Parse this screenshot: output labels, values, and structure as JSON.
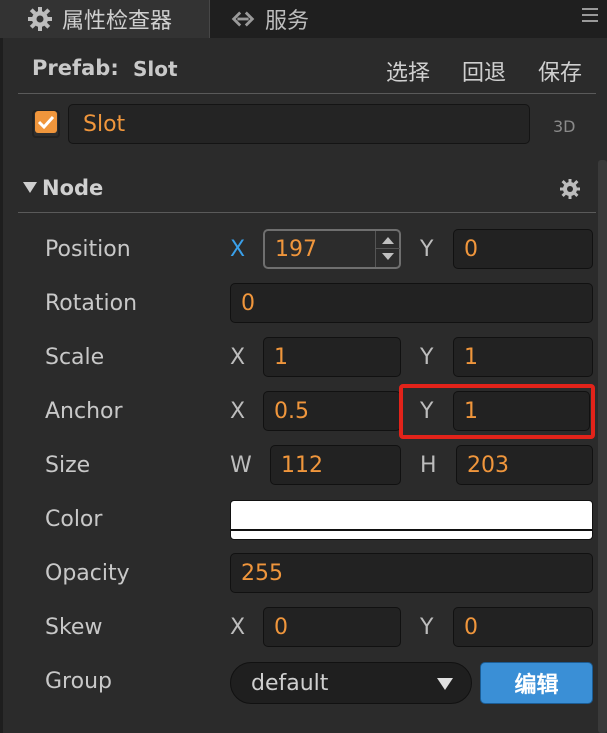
{
  "tabs": {
    "inspector": {
      "label": "属性检查器",
      "icon": "gear-icon"
    },
    "services": {
      "label": "服务",
      "icon": "link-icon"
    },
    "menu_icon": "hamburger-icon"
  },
  "prefab": {
    "label": "Prefab:",
    "name": "Slot",
    "select_label": "选择",
    "revert_label": "回退",
    "save_label": "保存"
  },
  "node_name": {
    "checked": true,
    "value": "Slot",
    "mode_label": "3D"
  },
  "node_section": {
    "title": "Node",
    "settings_icon": "gear-icon"
  },
  "properties": {
    "position": {
      "label": "Position",
      "x_axis": "X",
      "x": "197",
      "y_axis": "Y",
      "y": "0"
    },
    "rotation": {
      "label": "Rotation",
      "value": "0"
    },
    "scale": {
      "label": "Scale",
      "x_axis": "X",
      "x": "1",
      "y_axis": "Y",
      "y": "1"
    },
    "anchor": {
      "label": "Anchor",
      "x_axis": "X",
      "x": "0.5",
      "y_axis": "Y",
      "y": "1"
    },
    "size": {
      "label": "Size",
      "w_axis": "W",
      "w": "112",
      "h_axis": "H",
      "h": "203"
    },
    "color": {
      "label": "Color",
      "value": "#ffffff"
    },
    "opacity": {
      "label": "Opacity",
      "value": "255"
    },
    "skew": {
      "label": "Skew",
      "x_axis": "X",
      "x": "0",
      "y_axis": "Y",
      "y": "0"
    },
    "group": {
      "label": "Group",
      "value": "default",
      "edit_label": "编辑"
    }
  },
  "colors": {
    "value_text": "#f0963c",
    "active_axis": "#3aa0ea",
    "highlight": "#e2231a",
    "edit_button": "#3a8fd6"
  }
}
